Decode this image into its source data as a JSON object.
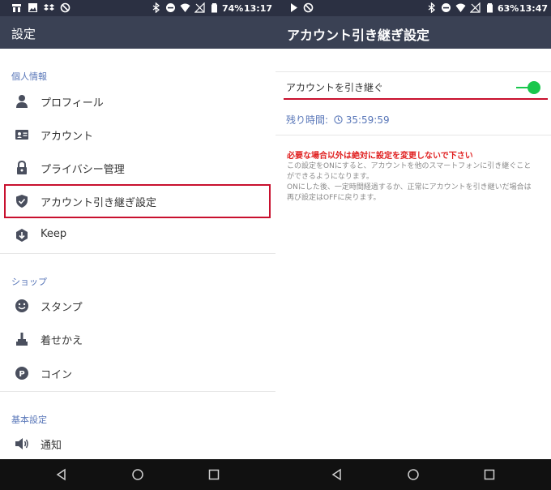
{
  "left": {
    "status": {
      "battery": "74%",
      "time": "13:17"
    },
    "appbar": {
      "title": "設定"
    },
    "sections": [
      {
        "header": "個人情報",
        "items": [
          {
            "label": "プロフィール",
            "icon": "person-icon"
          },
          {
            "label": "アカウント",
            "icon": "id-card-icon"
          },
          {
            "label": "プライバシー管理",
            "icon": "lock-icon"
          },
          {
            "label": "アカウント引き継ぎ設定",
            "icon": "shield-icon"
          },
          {
            "label": "Keep",
            "icon": "keep-icon"
          }
        ]
      },
      {
        "header": "ショップ",
        "items": [
          {
            "label": "スタンプ",
            "icon": "smiley-icon"
          },
          {
            "label": "着せかえ",
            "icon": "brush-icon"
          },
          {
            "label": "コイン",
            "icon": "coin-icon"
          }
        ]
      },
      {
        "header": "基本設定",
        "items": [
          {
            "label": "通知",
            "icon": "speaker-icon"
          }
        ]
      }
    ]
  },
  "right": {
    "status": {
      "battery": "63%",
      "time": "13:47"
    },
    "appbar": {
      "title": "アカウント引き継ぎ設定"
    },
    "toggle": {
      "label": "アカウントを引き継ぐ",
      "on": true
    },
    "remaining": {
      "label": "残り時間:",
      "value": "35:59:59"
    },
    "warning": "必要な場合以外は絶対に設定を変更しないで下さい",
    "description": [
      "この設定をONにすると、アカウントを他のスマートフォンに引き継ぐことができるようになります。",
      "ONにした後、一定時間経過するか、正常にアカウントを引き継いだ場合は再び設定はOFFに戻ります。"
    ]
  },
  "colors": {
    "statusbar": "#2b3042",
    "appbar": "#3a4154",
    "section_header": "#5876b8",
    "highlight": "#c8102e",
    "toggle_on": "#19c74c",
    "warning": "#e02020"
  }
}
